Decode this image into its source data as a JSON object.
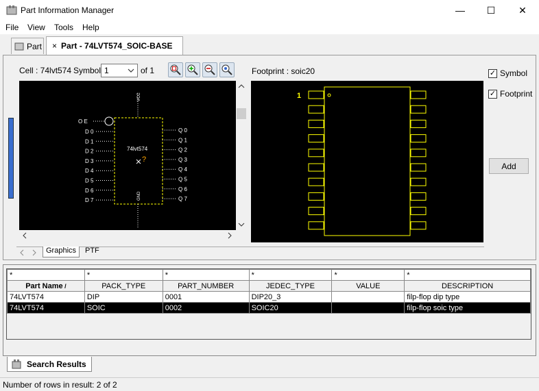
{
  "window": {
    "title": "Part Information Manager",
    "minimize": "—",
    "maximize": "☐",
    "close": "✕"
  },
  "menu": [
    "File",
    "View",
    "Tools",
    "Help"
  ],
  "tabs": {
    "part": "Part",
    "active_close": "×",
    "active": "Part - 74LVT574_SOIC-BASE"
  },
  "symbol_panel": {
    "cell_label": "Cell : 74lvt574",
    "symbol_label": "Symbol",
    "symbol_value": "1",
    "of_label": "of 1"
  },
  "symbol_graphic": {
    "top_pin": "VCC",
    "bottom_pin": "GND",
    "body_label": "74lvt574",
    "body_marker": "?",
    "oe_label": "O E",
    "left_pins": [
      "D 0",
      "D 1",
      "D 2",
      "D 3",
      "D 4",
      "D 5",
      "D 6",
      "D 7"
    ],
    "right_pins": [
      "Q 0",
      "Q 1",
      "Q 2",
      "Q 3",
      "Q 4",
      "Q 5",
      "Q 6",
      "Q 7"
    ]
  },
  "footprint_panel": {
    "label": "Footprint : soic20",
    "pin1": "1"
  },
  "options": {
    "symbol": "Symbol",
    "footprint": "Footprint",
    "add": "Add"
  },
  "subtabs": {
    "graphics": "Graphics",
    "ptf": "PTF"
  },
  "grid": {
    "filters": [
      "*",
      "*",
      "*",
      "*",
      "*",
      "*"
    ],
    "columns": [
      "Part Name",
      "PACK_TYPE",
      "PART_NUMBER",
      "JEDEC_TYPE",
      "VALUE",
      "DESCRIPTION"
    ],
    "sort_indicator": "/",
    "rows": [
      [
        "74LVT574",
        "DIP",
        "0001",
        "DIP20_3",
        "",
        "filp-flop dip type"
      ],
      [
        "74LVT574",
        "SOIC",
        "0002",
        "SOIC20",
        "",
        "filp-flop soic type"
      ]
    ],
    "selected_row": 1
  },
  "results_tab": "Search Results",
  "status": "Number of rows in result: 2 of 2",
  "colors": {
    "canvas_bg": "#000000",
    "symbol_line": "#ffffff",
    "symbol_body": "#ffff00",
    "footprint_line": "#ffff00",
    "accent": "#3b6fcf"
  }
}
